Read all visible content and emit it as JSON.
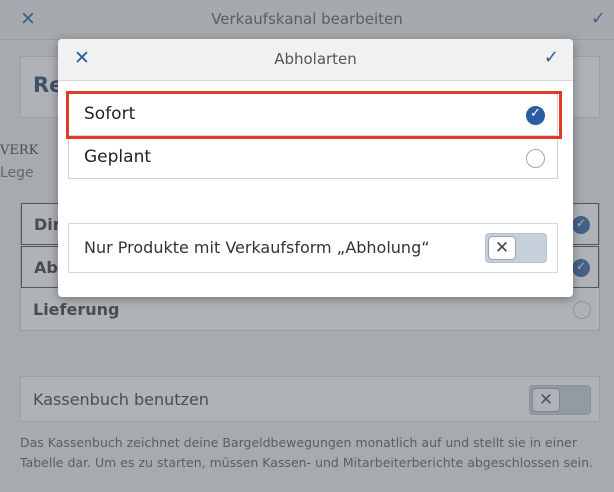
{
  "background": {
    "header": {
      "close_icon": "close-icon",
      "title": "Verkaufskanal bearbeiten",
      "confirm_icon": "check-icon"
    },
    "restaurant_name_partial": "Re",
    "section_title_partial": "VERK",
    "legend_partial": "Lege",
    "sales_types": [
      {
        "label": "Dir",
        "selected": true
      },
      {
        "label": "Ab",
        "selected": true
      },
      {
        "label": "Lieferung",
        "selected": false
      }
    ],
    "cashbook": {
      "label": "Kassenbuch benutzen",
      "toggle_symbol": "✕",
      "enabled": false,
      "description": "Das Kassenbuch zeichnet deine Bargeldbewegungen monatlich auf und stellt sie in einer Tabelle dar. Um es zu starten, müssen Kassen- und Mitarbeiterberichte abgeschlossen sein."
    }
  },
  "modal": {
    "close_symbol": "✕",
    "confirm_symbol": "✓",
    "title": "Abholarten",
    "options": [
      {
        "label": "Sofort",
        "selected": true
      },
      {
        "label": "Geplant",
        "selected": false
      }
    ],
    "pickup_only_toggle": {
      "label": "Nur Produkte mit Verkaufsform „Abholung“",
      "symbol": "✕",
      "enabled": false
    }
  },
  "colors": {
    "accent": "#2a5d9f",
    "highlight": "#e03a2a"
  }
}
